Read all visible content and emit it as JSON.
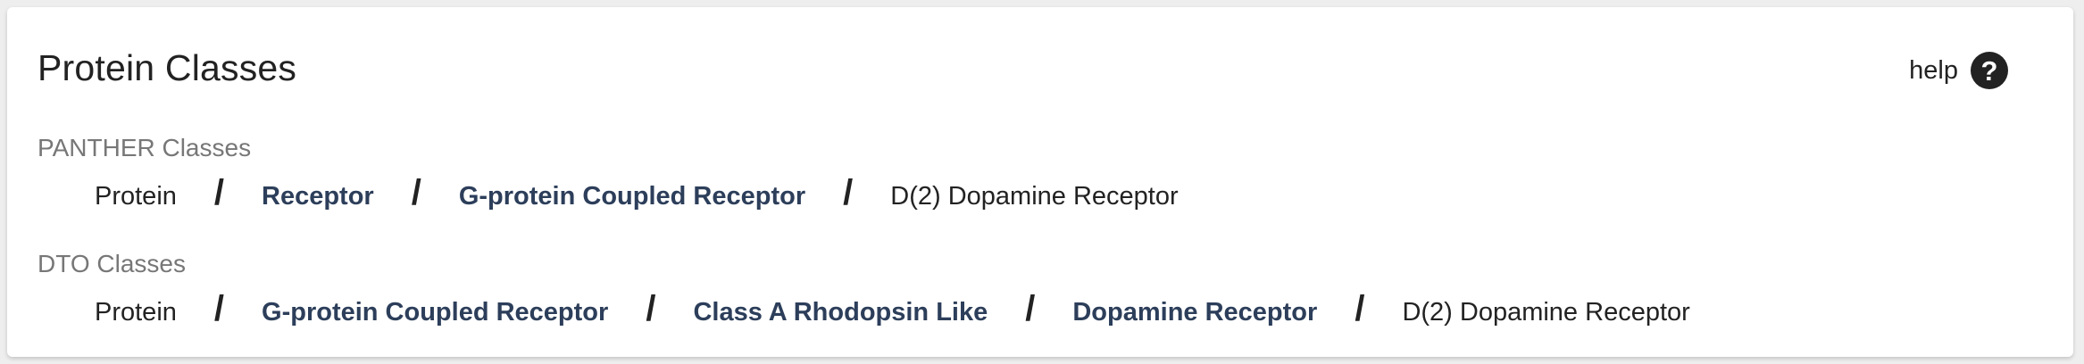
{
  "card": {
    "title": "Protein Classes",
    "help_label": "help",
    "help_icon": "?"
  },
  "panther": {
    "label": "PANTHER Classes",
    "separator": "/",
    "items": [
      {
        "label": "Protein",
        "link": false
      },
      {
        "label": "Receptor",
        "link": true
      },
      {
        "label": "G-protein Coupled Receptor",
        "link": true
      },
      {
        "label": "D(2) Dopamine Receptor",
        "link": false
      }
    ]
  },
  "dto": {
    "label": "DTO Classes",
    "separator": "/",
    "items": [
      {
        "label": "Protein",
        "link": false
      },
      {
        "label": "G-protein Coupled Receptor",
        "link": true
      },
      {
        "label": "Class A Rhodopsin Like",
        "link": true
      },
      {
        "label": "Dopamine Receptor",
        "link": true
      },
      {
        "label": "D(2) Dopamine Receptor",
        "link": false
      }
    ]
  }
}
